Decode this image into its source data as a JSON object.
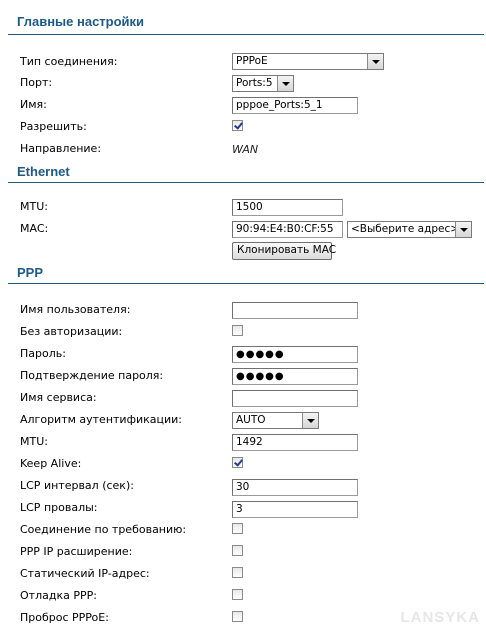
{
  "main": {
    "title": "Главные настройки",
    "connection_type_label": "Тип соединения:",
    "connection_type_value": "PPPoE",
    "port_label": "Порт:",
    "port_value": "Ports:5",
    "name_label": "Имя:",
    "name_value": "pppoe_Ports:5_1",
    "enable_label": "Разрешить:",
    "enable_checked": true,
    "direction_label": "Направление:",
    "direction_value": "WAN"
  },
  "ethernet": {
    "title": "Ethernet",
    "mtu_label": "MTU:",
    "mtu_value": "1500",
    "mac_label": "MAC:",
    "mac_value": "90:94:E4:B0:CF:55",
    "mac_select_value": "<Выберите адрес>",
    "clone_mac_button": "Клонировать MAC"
  },
  "ppp": {
    "title": "PPP",
    "username_label": "Имя пользователя:",
    "username_value": "",
    "no_auth_label": "Без авторизации:",
    "no_auth_checked": false,
    "password_label": "Пароль:",
    "password_value": "●●●●●",
    "password_confirm_label": "Подтверждение пароля:",
    "password_confirm_value": "●●●●●",
    "service_label": "Имя сервиса:",
    "service_value": "",
    "auth_algo_label": "Алгоритм аутентификации:",
    "auth_algo_value": "AUTO",
    "mtu_label": "MTU:",
    "mtu_value": "1492",
    "keep_alive_label": "Keep Alive:",
    "keep_alive_checked": true,
    "lcp_interval_label": "LCP интервал (сек):",
    "lcp_interval_value": "30",
    "lcp_failures_label": "LCP провалы:",
    "lcp_failures_value": "3",
    "on_demand_label": "Соединение по требованию:",
    "on_demand_checked": false,
    "ip_ext_label": "PPP IP расширение:",
    "ip_ext_checked": false,
    "static_ip_label": "Статический IP-адрес:",
    "static_ip_checked": false,
    "debug_label": "Отладка PPP:",
    "debug_checked": false,
    "passthrough_label": "Проброс PPPoE:",
    "passthrough_checked": false
  },
  "watermark": "LANSYKA",
  "colors": {
    "section_title": "#1f5a84",
    "rule": "#1f5a84",
    "check": "#2a3a8a"
  }
}
